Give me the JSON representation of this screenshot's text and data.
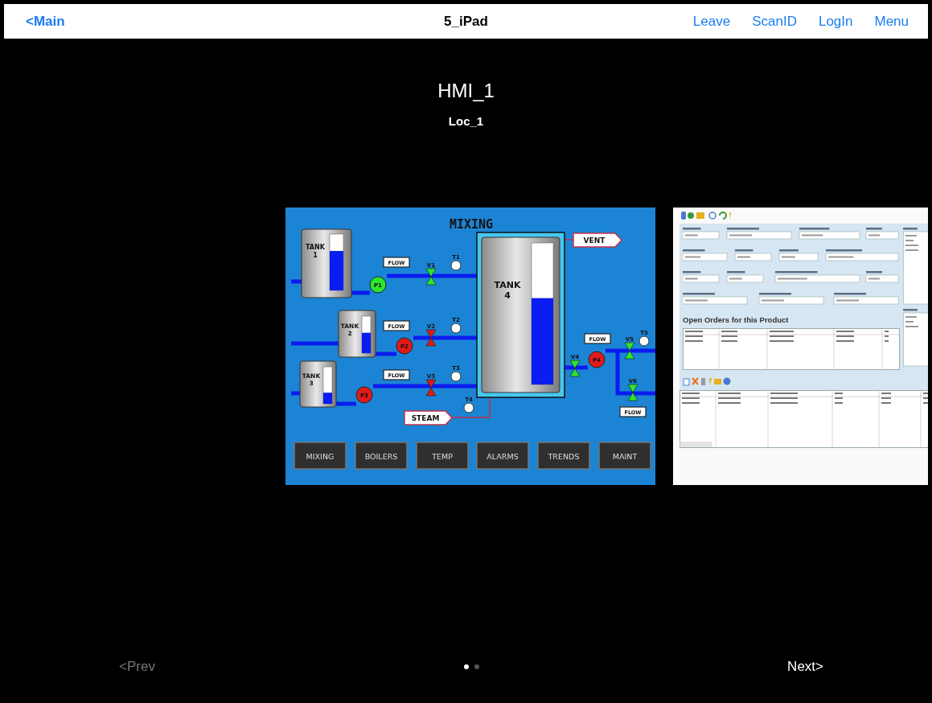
{
  "nav": {
    "back": "<Main",
    "title": "5_iPad",
    "actions": [
      "Leave",
      "ScanID",
      "LogIn",
      "Menu"
    ]
  },
  "screen": {
    "title": "HMI_1",
    "location": "Loc_1"
  },
  "hmi": {
    "title": "MIXING",
    "tanks": [
      {
        "label": "TANK",
        "number": "1",
        "level": 0.7
      },
      {
        "label": "TANK",
        "number": "2",
        "level": 0.55
      },
      {
        "label": "TANK",
        "number": "3",
        "level": 0.3
      },
      {
        "label": "TANK",
        "number": "4",
        "level": 0.61
      }
    ],
    "pumps": [
      {
        "label": "P1",
        "on": true
      },
      {
        "label": "P2",
        "on": false
      },
      {
        "label": "P3",
        "on": false
      },
      {
        "label": "P4",
        "on": false
      }
    ],
    "valves": [
      {
        "label": "V1",
        "open": true
      },
      {
        "label": "V2",
        "open": false
      },
      {
        "label": "V3",
        "open": false
      },
      {
        "label": "V4",
        "open": true
      },
      {
        "label": "V5",
        "open": true
      },
      {
        "label": "V6",
        "open": true
      }
    ],
    "gauges": [
      "T1",
      "T2",
      "T3",
      "T4",
      "T5"
    ],
    "flow_tags": [
      "FLOW",
      "FLOW",
      "FLOW",
      "FLOW",
      "FLOW"
    ],
    "vent": "VENT",
    "steam": "STEAM",
    "buttons": [
      "MIXING",
      "BOILERS",
      "TEMP",
      "ALARMS",
      "TRENDS",
      "MAINT"
    ]
  },
  "form": {
    "orders_title": "Open Orders for this Product"
  },
  "pager": {
    "prev": "<Prev",
    "prev_disabled": true,
    "next": "Next>",
    "dots": [
      {
        "selected": true
      },
      {
        "selected": false
      }
    ]
  }
}
